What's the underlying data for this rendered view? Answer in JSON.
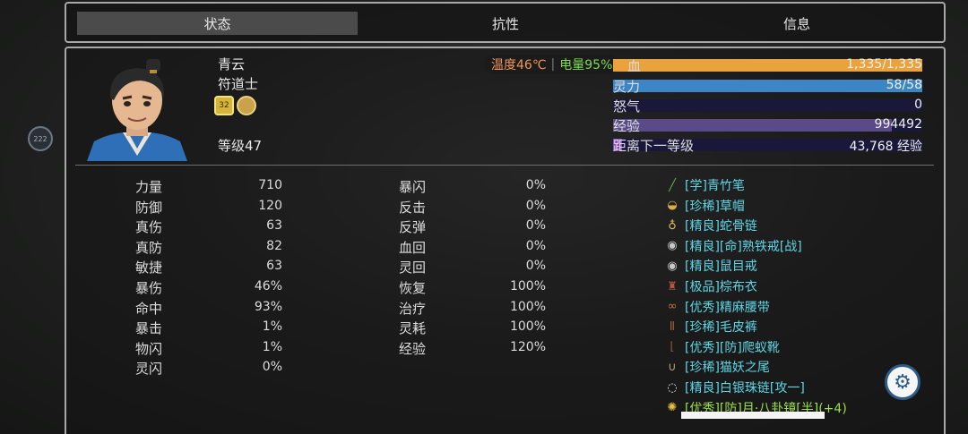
{
  "side_bubble": "222",
  "tabs": [
    {
      "label": "状态",
      "active": true
    },
    {
      "label": "抗性",
      "active": false
    },
    {
      "label": "信息",
      "active": false
    }
  ],
  "character": {
    "name": "青云",
    "class": "符道士",
    "badge_number": "32",
    "level_text": "等级47"
  },
  "status_overlay": {
    "temperature": "温度46℃",
    "battery": "电量95%"
  },
  "bars": [
    {
      "label": "血",
      "value": "1,335/1,335",
      "fill": 1.0,
      "color": "#e9a23c"
    },
    {
      "label": "灵力",
      "value": "58/58",
      "fill": 1.0,
      "color": "#3d86c6"
    },
    {
      "label": "怒气",
      "value": "0",
      "fill": 0,
      "color": "#3d86c6"
    },
    {
      "label": "经验",
      "value": "994492",
      "fill": 0.9,
      "color": "#5a4a8a"
    },
    {
      "label": "距离下一等级",
      "value": "43,768 经验",
      "fill": 0.03,
      "color": "#8a4ac8"
    }
  ],
  "stats_left": [
    {
      "label": "力量",
      "value": "710"
    },
    {
      "label": "防御",
      "value": "120"
    },
    {
      "label": "真伤",
      "value": "63"
    },
    {
      "label": "真防",
      "value": "82"
    },
    {
      "label": "敏捷",
      "value": "63"
    },
    {
      "label": "暴伤",
      "value": "46%"
    },
    {
      "label": "命中",
      "value": "93%"
    },
    {
      "label": "暴击",
      "value": "1%"
    },
    {
      "label": "物闪",
      "value": "1%"
    },
    {
      "label": "灵闪",
      "value": "0%"
    }
  ],
  "stats_mid": [
    {
      "label": "暴闪",
      "value": "0%"
    },
    {
      "label": "反击",
      "value": "0%"
    },
    {
      "label": "反弹",
      "value": "0%"
    },
    {
      "label": "血回",
      "value": "0%"
    },
    {
      "label": "灵回",
      "value": "0%"
    },
    {
      "label": "恢复",
      "value": "100%"
    },
    {
      "label": "治疗",
      "value": "100%"
    },
    {
      "label": "灵耗",
      "value": "100%"
    },
    {
      "label": "经验",
      "value": "120%"
    }
  ],
  "equipment": [
    {
      "text": "[学]青竹笔",
      "icon": "brush-icon",
      "color": "#5fd6e6"
    },
    {
      "text": "[珍稀]草帽",
      "icon": "hat-icon",
      "color": "#5fd6e6"
    },
    {
      "text": "[精良]蛇骨链",
      "icon": "necklace-icon",
      "color": "#5fd6e6"
    },
    {
      "text": "[精良][命]熟铁戒[战]",
      "icon": "ring-icon",
      "color": "#5fd6e6"
    },
    {
      "text": "[精良]鼠目戒",
      "icon": "ring-icon",
      "color": "#5fd6e6"
    },
    {
      "text": "[极品]棕布衣",
      "icon": "robe-icon",
      "color": "#5fd6e6"
    },
    {
      "text": "[优秀]精麻腰带",
      "icon": "belt-icon",
      "color": "#5fd6e6"
    },
    {
      "text": "[珍稀]毛皮裤",
      "icon": "pants-icon",
      "color": "#5fd6e6"
    },
    {
      "text": "[优秀][防]爬蚁靴",
      "icon": "boots-icon",
      "color": "#5fd6e6"
    },
    {
      "text": "[珍稀]猫妖之尾",
      "icon": "tail-icon",
      "color": "#5fd6e6"
    },
    {
      "text": "[精良]白银珠链[攻一]",
      "icon": "beads-icon",
      "color": "#5fd6e6"
    },
    {
      "text": "[优秀][防]月·八卦镜[半](+4)",
      "icon": "mirror-icon",
      "color": "#9ee04a"
    }
  ]
}
